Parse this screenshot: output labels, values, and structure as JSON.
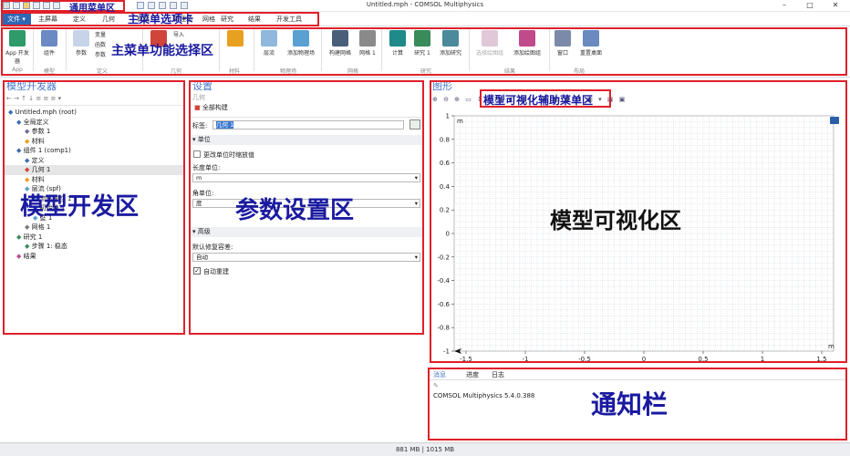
{
  "window": {
    "title": "Untitled.mph - COMSOL Multiphysics"
  },
  "tabs": [
    "文件 ▾",
    "主屏幕",
    "定义",
    "几何",
    "材料",
    "物理场",
    "网格",
    "研究",
    "结果",
    "开发工具"
  ],
  "ribbon": {
    "buttons": [
      {
        "label": "App\n开发器"
      },
      {
        "label": "组件"
      },
      {
        "label": "参数"
      },
      {
        "label": "变量"
      },
      {
        "label": "函数"
      },
      {
        "label": "参数"
      },
      {
        "label": "导入"
      },
      {
        "label": "层流"
      },
      {
        "label": "添加物理场"
      },
      {
        "label": "构建网格"
      },
      {
        "label": "网格 1"
      },
      {
        "label": "计算"
      },
      {
        "label": "研究 1"
      },
      {
        "label": "添加研究"
      },
      {
        "label": "选择绘图组"
      },
      {
        "label": "添加绘图组"
      },
      {
        "label": "窗口"
      },
      {
        "label": "重置桌面"
      }
    ],
    "groups": [
      "App",
      "模型",
      "定义",
      "几何",
      "材料",
      "物理场",
      "网格",
      "研究",
      "结果",
      "布局"
    ]
  },
  "annotations": {
    "quick_menu": "通用菜单区",
    "tabs_menu": "主菜单选项卡",
    "ribbon_menu": "主菜单功能选择区",
    "model_area": "模型开发区",
    "settings_area": "参数设置区",
    "graphics_menu": "模型可视化辅助菜单区",
    "graphics_area": "模型可视化区",
    "message_area": "通知栏"
  },
  "model_builder": {
    "title": "模型开发器",
    "tree": [
      {
        "label": "Untitled.mph (root)",
        "indent": 0
      },
      {
        "label": "全局定义",
        "indent": 1
      },
      {
        "label": "参数 1",
        "indent": 2
      },
      {
        "label": "材料",
        "indent": 2
      },
      {
        "label": "组件 1 (comp1)",
        "indent": 1
      },
      {
        "label": "定义",
        "indent": 2
      },
      {
        "label": "几何 1",
        "indent": 2
      },
      {
        "label": "材料",
        "indent": 2
      },
      {
        "label": "层流 (spf)",
        "indent": 2
      },
      {
        "label": "流体属性 1",
        "indent": 3
      },
      {
        "label": "初始值 1",
        "indent": 3
      },
      {
        "label": "壁 1",
        "indent": 3
      },
      {
        "label": "网格 1",
        "indent": 2
      },
      {
        "label": "研究 1",
        "indent": 1
      },
      {
        "label": "步骤 1: 稳态",
        "indent": 2
      },
      {
        "label": "结果",
        "indent": 1
      }
    ]
  },
  "settings": {
    "title": "设置",
    "subtitle": "几何",
    "build_all": "全部构建",
    "label_caption": "标签:",
    "label_value": "几何 1",
    "units_section": "单位",
    "scale_checkbox": "更改单位时缩放值",
    "length_unit_caption": "长度单位:",
    "length_unit_value": "m",
    "angle_unit_caption": "角单位:",
    "angle_unit_value": "度",
    "advanced_section": "高级",
    "repair_caption": "默认修复容差:",
    "repair_value": "自动",
    "auto_rebuild": "自动重建"
  },
  "graphics": {
    "title": "图形",
    "y_axis_label": "m",
    "x_axis_label": "m"
  },
  "messages": {
    "tabs": [
      "消息",
      "进度",
      "日志"
    ],
    "text": "COMSOL Multiphysics 5.4.0.388"
  },
  "status": {
    "memory": "881 MB | 1015 MB"
  },
  "chart_data": {
    "type": "scatter",
    "x_ticks": [
      "-1.5",
      "-1",
      "-0.5",
      "0",
      "0.5",
      "1",
      "1.5"
    ],
    "y_ticks": [
      "1",
      "0.8",
      "0.6",
      "0.4",
      "0.2",
      "0",
      "-0.2",
      "-0.4",
      "-0.6",
      "-0.8",
      "-1"
    ],
    "xlim": [
      -1.6,
      1.6
    ],
    "ylim": [
      -1,
      1
    ],
    "grid": true
  }
}
